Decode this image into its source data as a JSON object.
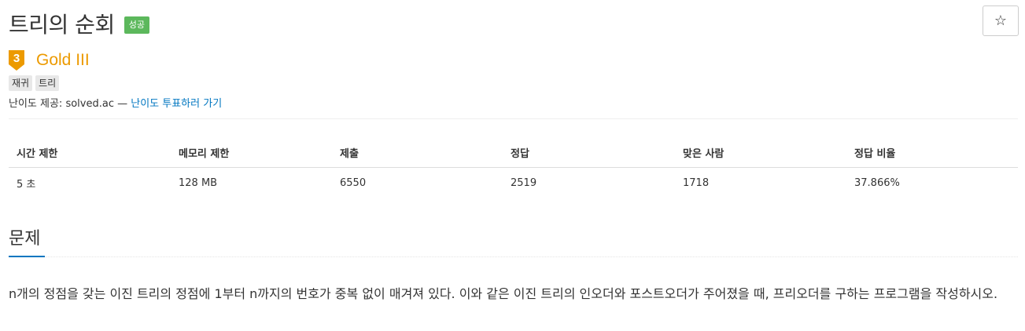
{
  "problem": {
    "title": "트리의 순회",
    "status_badge": "성공",
    "tier": {
      "level": "3",
      "name": "Gold III",
      "color": "#ec9a00"
    },
    "tags": [
      "재귀",
      "트리"
    ],
    "difficulty_prefix": "난이도 제공: solved.ac — ",
    "difficulty_link": "난이도 투표하러 가기",
    "star_icon": "☆"
  },
  "stats": {
    "headers": [
      "시간 제한",
      "메모리 제한",
      "제출",
      "정답",
      "맞은 사람",
      "정답 비율"
    ],
    "values": [
      "5 초",
      "128 MB",
      "6550",
      "2519",
      "1718",
      "37.866%"
    ]
  },
  "section": {
    "title": "문제",
    "text": "n개의 정점을 갖는 이진 트리의 정점에 1부터 n까지의 번호가 중복 없이 매겨져 있다. 이와 같은 이진 트리의 인오더와 포스트오더가 주어졌을 때, 프리오더를 구하는 프로그램을 작성하시오."
  },
  "colors": {
    "accent": "#0076c0",
    "success": "#5cb85c",
    "gold": "#ec9a00"
  }
}
